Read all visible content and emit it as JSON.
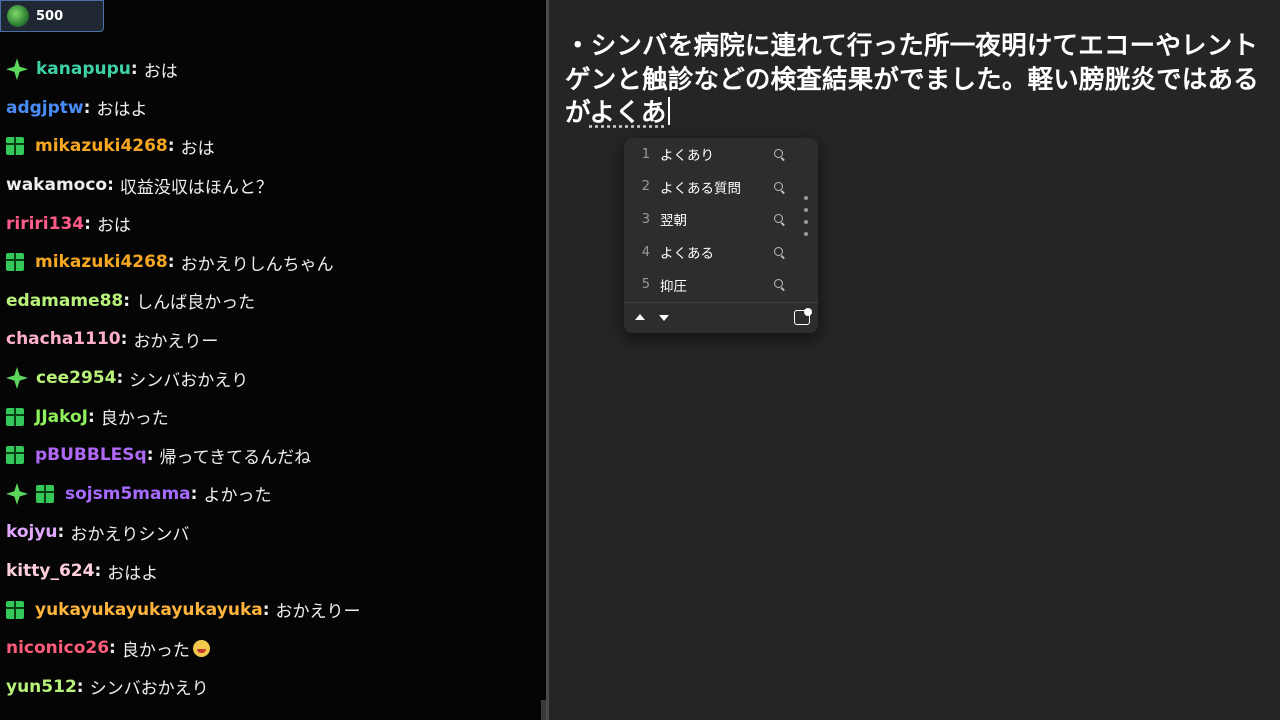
{
  "points_badge": {
    "value": "500"
  },
  "chat": {
    "messages": [
      {
        "user": "kanapupu",
        "color": "#3fd1a6",
        "badges": [
          "sparkle"
        ],
        "text": "おは"
      },
      {
        "user": "adgjptw",
        "color": "#4a8cf7",
        "badges": [],
        "text": "おはよ"
      },
      {
        "user": "mikazuki4268",
        "color": "#f5a623",
        "badges": [
          "gift"
        ],
        "text": "おは"
      },
      {
        "user": "wakamoco",
        "color": "#efeff1",
        "badges": [],
        "text": "収益没収はほんと？"
      },
      {
        "user": "ririri134",
        "color": "#ff5c8a",
        "badges": [],
        "text": "おは"
      },
      {
        "user": "mikazuki4268",
        "color": "#f5a623",
        "badges": [
          "gift"
        ],
        "text": "おかえりしんちゃん"
      },
      {
        "user": "edamame88",
        "color": "#b8f27a",
        "badges": [],
        "text": "しんば良かった"
      },
      {
        "user": "chacha1110",
        "color": "#ffb0c8",
        "badges": [],
        "text": "おかえりー"
      },
      {
        "user": "cee2954",
        "color": "#b8f27a",
        "badges": [
          "sparkle"
        ],
        "text": "シンバおかえり"
      },
      {
        "user": "JJakoJ",
        "color": "#8ef25c",
        "badges": [
          "gift"
        ],
        "text": "良かった"
      },
      {
        "user": "pBUBBLESq",
        "color": "#b068f7",
        "badges": [
          "gift"
        ],
        "text": "帰ってきてるんだね"
      },
      {
        "user": "sojsm5mama",
        "color": "#a66bff",
        "badges": [
          "sparkle",
          "gift"
        ],
        "text": "よかった"
      },
      {
        "user": "kojyu",
        "color": "#e0a8ff",
        "badges": [],
        "text": "おかえりシンバ"
      },
      {
        "user": "kitty_624",
        "color": "#ffd0dc",
        "badges": [],
        "text": "おはよ"
      },
      {
        "user": "yukayukayukayukayuka",
        "color": "#ffb43d",
        "badges": [
          "gift"
        ],
        "text": "おかえりー"
      },
      {
        "user": "niconico26",
        "color": "#ff5c7a",
        "badges": [],
        "text": "良かった",
        "emote": "flushed-face-emote"
      },
      {
        "user": "yun512",
        "color": "#b8f27a",
        "badges": [],
        "text": "シンバおかえり"
      }
    ]
  },
  "editor": {
    "text": "・シンバを病院に連れて行った所一夜明けてエコーやレントゲンと触診などの検査結果がでました。軽い膀胱炎ではあるが",
    "composition": "よくあ"
  },
  "ime": {
    "candidates": [
      {
        "num": "1",
        "word": "よくあり"
      },
      {
        "num": "2",
        "word": "よくある質問"
      },
      {
        "num": "3",
        "word": "翌朝"
      },
      {
        "num": "4",
        "word": "よくある"
      },
      {
        "num": "5",
        "word": "抑圧"
      }
    ]
  }
}
